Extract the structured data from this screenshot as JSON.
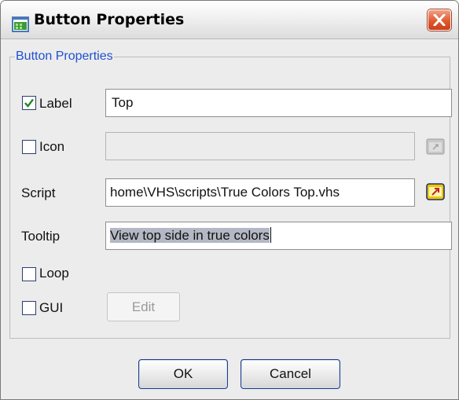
{
  "window": {
    "title": "Button Properties",
    "title_icon": "app-icon",
    "close_icon": "close-icon"
  },
  "group": {
    "legend": "Button Properties"
  },
  "label_row": {
    "checkbox_label": "Label",
    "checked": true,
    "value": "Top"
  },
  "icon_row": {
    "checkbox_label": "Icon",
    "checked": false,
    "value": "",
    "browse_icon": "folder-icon"
  },
  "script_row": {
    "label": "Script",
    "value": "home\\VHS\\scripts\\True Colors Top.vhs",
    "browse_icon": "folder-open-icon"
  },
  "tooltip_row": {
    "label": "Tooltip",
    "value": "View top side in true colors"
  },
  "loop_row": {
    "checkbox_label": "Loop",
    "checked": false
  },
  "gui_row": {
    "checkbox_label": "GUI",
    "checked": false,
    "edit_label": "Edit"
  },
  "buttons": {
    "ok": "OK",
    "cancel": "Cancel"
  },
  "colors": {
    "accent": "#2050d0",
    "close": "#e2592f",
    "background": "#ececec"
  }
}
